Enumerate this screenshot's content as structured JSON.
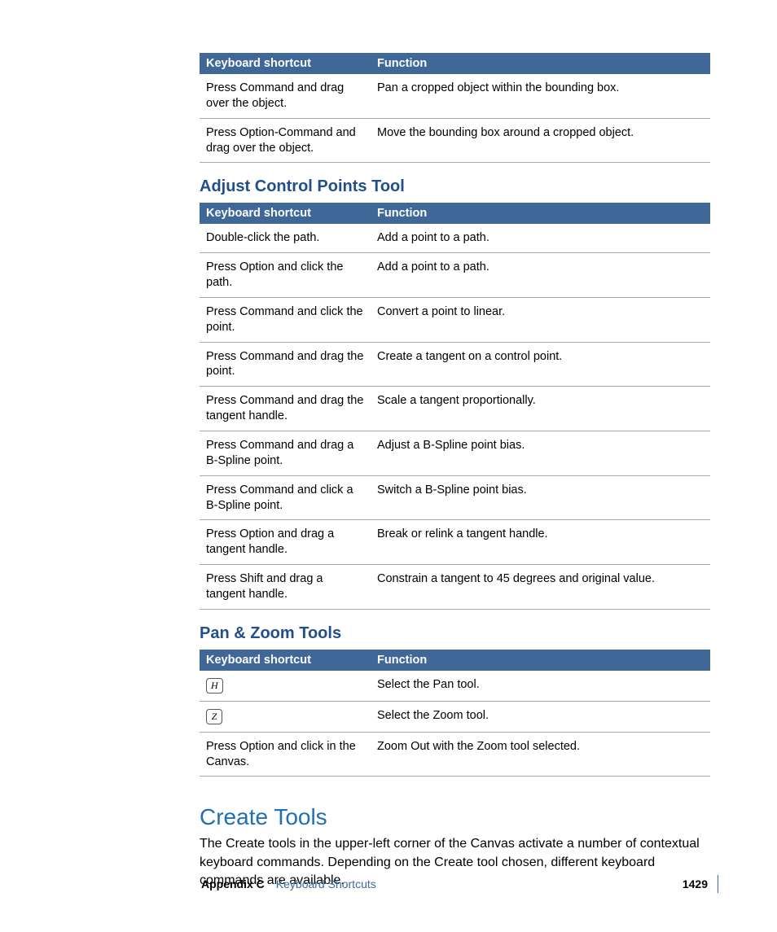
{
  "headers": {
    "shortcut": "Keyboard shortcut",
    "function": "Function"
  },
  "table1": {
    "rows": [
      {
        "s": "Press Command and drag over the object.",
        "f": "Pan a cropped object within the bounding box."
      },
      {
        "s": "Press Option-Command and drag over the object.",
        "f": "Move the bounding box around a cropped object."
      }
    ]
  },
  "section2": {
    "title": "Adjust Control Points Tool",
    "rows": [
      {
        "s": "Double-click the path.",
        "f": "Add a point to a path."
      },
      {
        "s": "Press Option and click the path.",
        "f": "Add a point to a path."
      },
      {
        "s": "Press Command and click the point.",
        "f": "Convert a point to linear."
      },
      {
        "s": "Press Command and drag the point.",
        "f": "Create a tangent on a control point."
      },
      {
        "s": "Press Command and drag the tangent handle.",
        "f": "Scale a tangent proportionally."
      },
      {
        "s": "Press Command and drag a B-Spline point.",
        "f": "Adjust a B-Spline point bias."
      },
      {
        "s": "Press Command and click a B-Spline point.",
        "f": "Switch a B-Spline point bias."
      },
      {
        "s": "Press Option and drag a tangent handle.",
        "f": "Break or relink a tangent handle."
      },
      {
        "s": "Press Shift and drag a tangent handle.",
        "f": "Constrain a tangent to 45 degrees and original value."
      }
    ]
  },
  "section3": {
    "title": "Pan & Zoom Tools",
    "rows": [
      {
        "key": "H",
        "f": "Select the Pan tool."
      },
      {
        "key": "Z",
        "f": "Select the Zoom tool."
      },
      {
        "s": "Press Option and click in the Canvas.",
        "f": "Zoom Out with the Zoom tool selected."
      }
    ]
  },
  "section4": {
    "title": "Create Tools",
    "body": "The Create tools in the upper-left corner of the Canvas activate a number of contextual keyboard commands. Depending on the Create tool chosen, different keyboard commands are available."
  },
  "footer": {
    "appendix": "Appendix C",
    "chapter": "Keyboard Shortcuts",
    "page": "1429"
  }
}
